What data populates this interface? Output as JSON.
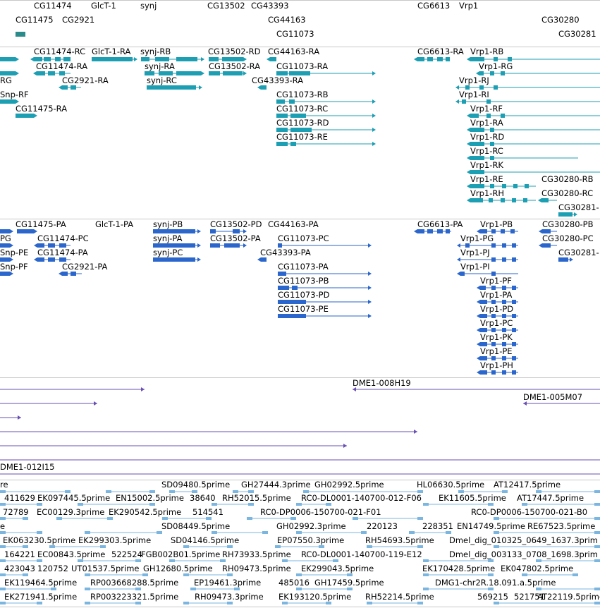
{
  "colors": {
    "gene": "#2b8a8a",
    "transcript": "#1c9eb3",
    "protein": "#2a66cc",
    "clone": "#6a4fb5",
    "est": "#7ab6e0"
  },
  "tracks": {
    "genes": {
      "labels": [
        "CG11474",
        "GlcT-1",
        "synj",
        "CG13502",
        "CG43393",
        "CG6613",
        "Vrp1",
        "CG11475",
        "CG2921",
        "CG44163",
        "CG30280",
        "CG11073",
        "CG30281"
      ]
    },
    "transcripts": {
      "labels": [
        "CG11474-RC",
        "GlcT-1-RA",
        "synj-RB",
        "CG13502-RD",
        "CG44163-RA",
        "CG6613-RA",
        "Vrp1-RB",
        "CG11474-RA",
        "synj-RA",
        "CG13502-RA",
        "CG11073-RA",
        "Vrp1-RG",
        "RG",
        "CG2921-RA",
        "synj-RC",
        "CG43393-RA",
        "Vrp1-RJ",
        "Snp-RF",
        "CG11073-RB",
        "Vrp1-RI",
        "CG11475-RA",
        "CG11073-RC",
        "Vrp1-RF",
        "CG11073-RD",
        "Vrp1-RA",
        "CG11073-RE",
        "Vrp1-RD",
        "Vrp1-RC",
        "Vrp1-RK",
        "Vrp1-RE",
        "CG30280-RB",
        "Vrp1-RH",
        "CG30280-RC",
        "CG30281-"
      ]
    },
    "proteins": {
      "labels": [
        "CG11475-PA",
        "GlcT-1-PA",
        "synj-PB",
        "CG13502-PD",
        "CG44163-PA",
        "CG6613-PA",
        "Vrp1-PB",
        "CG30280-PB",
        "PG",
        "CG11474-PC",
        "synj-PA",
        "CG13502-PA",
        "CG11073-PC",
        "Vrp1-PG",
        "CG30280-PC",
        "Snp-PE",
        "CG11474-PA",
        "synj-PC",
        "CG43393-PA",
        "Vrp1-PJ",
        "CG30281-",
        "Snp-PF",
        "CG2921-PA",
        "CG11073-PA",
        "Vrp1-PI",
        "CG11073-PB",
        "Vrp1-PF",
        "CG11073-PD",
        "Vrp1-PA",
        "CG11073-PE",
        "Vrp1-PD",
        "Vrp1-PC",
        "Vrp1-PK",
        "Vrp1-PE",
        "Vrp1-PH"
      ]
    },
    "clones": {
      "labels": [
        "DME1-008H19",
        "DME1-005M07",
        "DME1-012I15"
      ]
    },
    "ests": {
      "labels": [
        "re",
        "SD09480.5prime",
        "GH27444.3prime",
        "GH02992.5prime",
        "HL06630.5prime",
        "AT12417.5prime",
        "411629",
        "EK097445.5prime",
        "EN15002.5prime",
        "38640",
        "RH52015.5prime",
        "RC0-DL0001-140700-012-F06",
        "EK11605.5prime",
        "AT17447.5prime",
        "72789",
        "EC00129.3prime",
        "EK290542.5prime",
        "514541",
        "RC0-DP0006-150700-021-F01",
        "RC0-DP0006-150700-021-B0",
        "e",
        "SD08449.5prime",
        "GH02992.3prime",
        "220123",
        "228351",
        "EN14749.5prime",
        "RE67523.5prime",
        "EK063230.5prime",
        "EK299303.5prime",
        "SD04146.5prime",
        "EP07550.3prime",
        "RH54693.5prime",
        "Dmel_dig_010325_0649_1637.3prim",
        "164221",
        "EC00843.5prime",
        "522524",
        "FGB002B01.5prime",
        "RH73933.5prime",
        "RC0-DL0001-140700-119-E12",
        "Dmel_dig_003133_0708_1698.3prim",
        "423043",
        "120752",
        "UT01537.5prime",
        "GH12680.5prime",
        "RH09473.5prime",
        "EK299043.5prime",
        "EK170428.5prime",
        "EK047802.5prime",
        "EK119464.5prime",
        "RP003668288.5prime",
        "EP19461.3prime",
        "485016",
        "GH17459.5prime",
        "DMG1-chr2R.18.091.a.5prime",
        "EK271941.5prime",
        "RP003223321.5prime",
        "RH09473.3prime",
        "EK193120.5prime",
        "RH52214.5prime",
        "569215",
        "521751",
        "AT22119.5prime"
      ]
    }
  }
}
